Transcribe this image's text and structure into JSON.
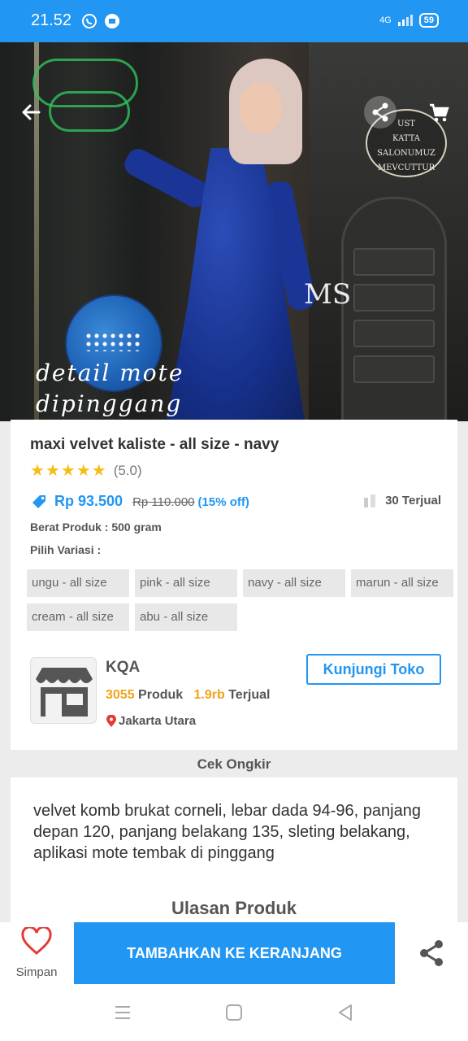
{
  "status_bar": {
    "time": "21.52",
    "network": "4G",
    "battery": "59"
  },
  "hero": {
    "caption_line1": "detail mote",
    "caption_line2": "dipinggang",
    "watermark": "MS",
    "sign_lines": [
      "UST",
      "KATTA",
      "SALONUMUZ",
      "MEVCUTTUR"
    ]
  },
  "product": {
    "title": "maxi velvet kaliste - all size - navy",
    "rating": "(5.0)",
    "stars": 5,
    "price": "Rp 93.500",
    "old_price": "Rp 110.000",
    "discount": "(15% off)",
    "sold": "30 Terjual",
    "weight": "Berat Produk : 500 gram",
    "variant_label": "Pilih Variasi :",
    "variants": [
      "ungu - all size",
      "pink - all size",
      "navy - all size",
      "marun - all size",
      "cream - all size",
      "abu - all size"
    ]
  },
  "store": {
    "name": "KQA",
    "product_count": "3055",
    "product_label": "Produk",
    "sold_count": "1.9rb",
    "sold_label": "Terjual",
    "location": "Jakarta Utara",
    "visit_label": "Kunjungi Toko"
  },
  "shipping": {
    "label": "Cek Ongkir"
  },
  "description": {
    "text": "velvet komb brukat corneli, lebar dada 94-96, panjang depan 120, panjang belakang 135, sleting belakang, aplikasi mote tembak di pinggang",
    "reviews_heading": "Ulasan Produk"
  },
  "bottom_bar": {
    "save_label": "Simpan",
    "add_to_cart_label": "TAMBAHKAN KE KERANJANG"
  },
  "colors": {
    "accent": "#2196f3",
    "star": "#f6bd16",
    "orange": "#f0a31b",
    "heart": "#e53935"
  },
  "icons": [
    "back-arrow-icon",
    "share-icon",
    "cart-icon",
    "tag-icon",
    "sold-icon",
    "store-icon",
    "location-pin-icon",
    "heart-icon",
    "menu-icon",
    "home-icon",
    "back-icon"
  ]
}
